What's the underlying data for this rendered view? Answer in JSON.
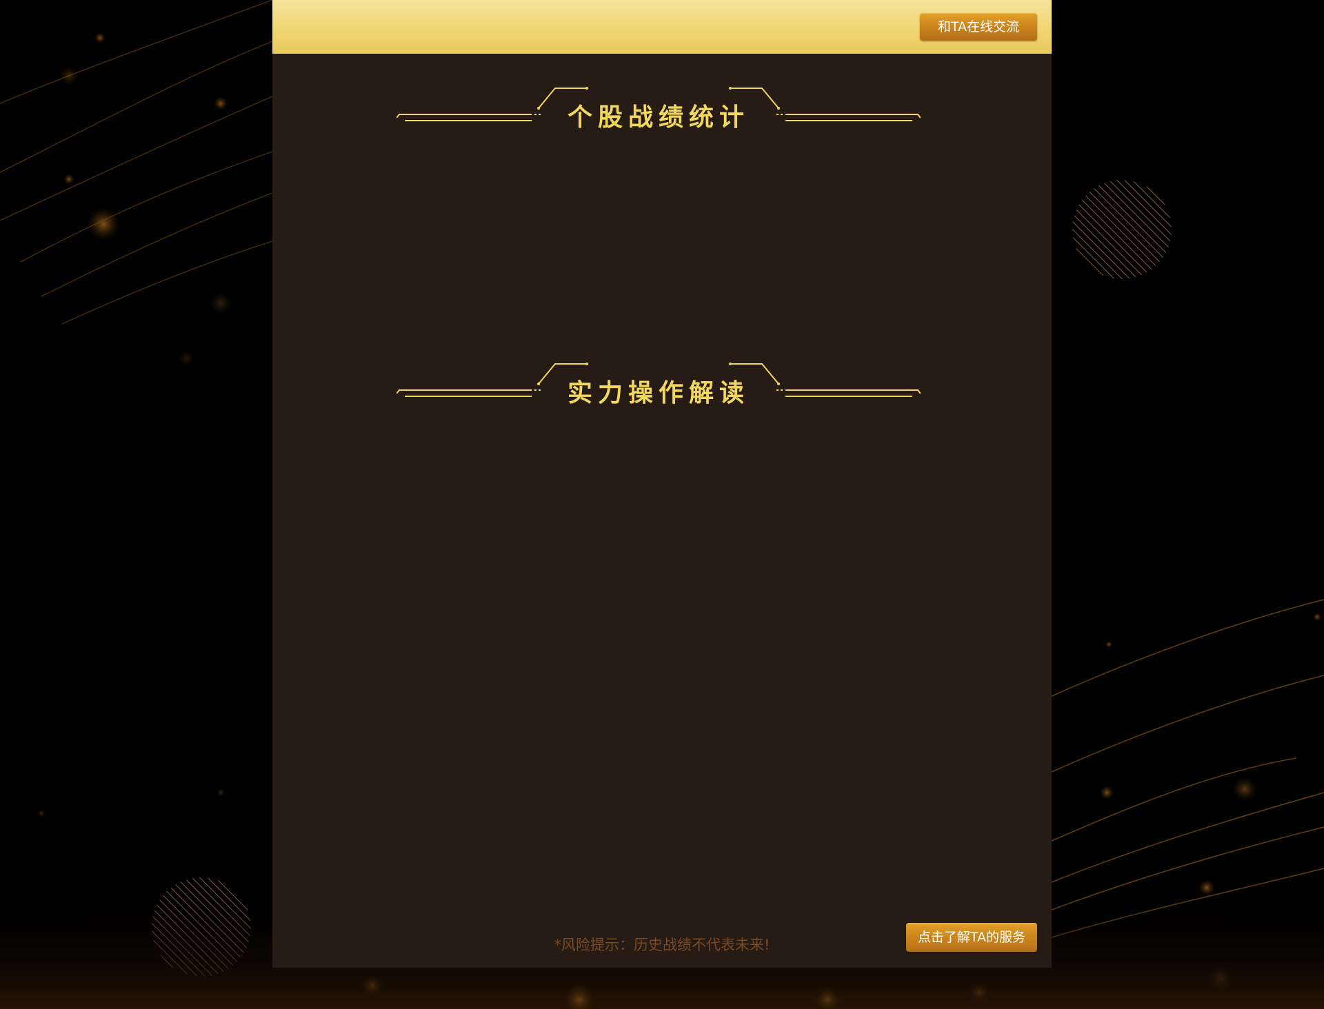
{
  "header": {
    "chat_button_label": "和TA在线交流"
  },
  "sections": [
    {
      "title": "个股战绩统计"
    },
    {
      "title": "实力操作解读"
    }
  ],
  "footer": {
    "risk_note": "*风险提示：历史战绩不代表未来!",
    "service_button_label": "点击了解TA的服务"
  },
  "colors": {
    "panel_background": "#271b15",
    "header_gold": "#efd46f",
    "title_gold": "#f3d85e",
    "button_orange": "#c9821c",
    "risk_text": "#7a4a24"
  }
}
